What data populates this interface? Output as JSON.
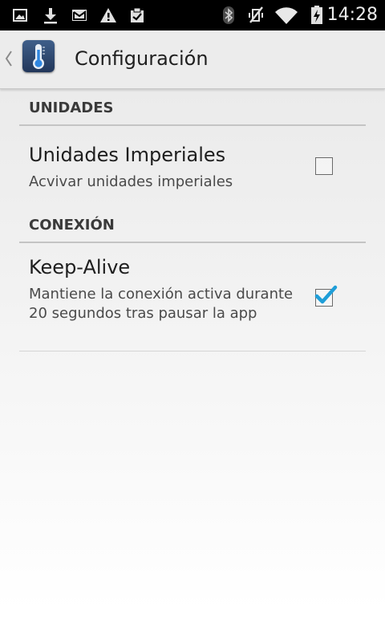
{
  "status_bar": {
    "time": "14:28",
    "left_icons": [
      "image-icon",
      "download-icon",
      "gmail-icon",
      "warning-icon",
      "clipboard-check-icon"
    ],
    "right_icons": [
      "bluetooth-icon",
      "vibrate-off-icon",
      "wifi-icon",
      "battery-charging-icon"
    ]
  },
  "action_bar": {
    "title": "Configuración",
    "app_icon": "thermometer-icon"
  },
  "sections": [
    {
      "header": "UNIDADES",
      "preferences": [
        {
          "title": "Unidades Imperiales",
          "summary": "Acvivar unidades imperiales",
          "checked": false
        }
      ]
    },
    {
      "header": "CONEXIÓN",
      "preferences": [
        {
          "title": "Keep-Alive",
          "summary": "Mantiene la conexión activa durante 20 segundos tras pausar la app",
          "checked": true
        }
      ]
    }
  ],
  "colors": {
    "status_bar_bg": "#000000",
    "action_bar_bg": "#ececec",
    "checkmark": "#1f9ed8"
  }
}
